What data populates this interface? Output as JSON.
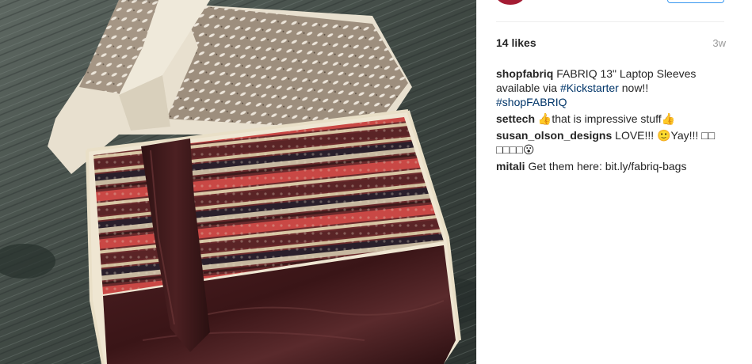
{
  "post": {
    "likes": "14 likes",
    "time": "3w"
  },
  "caption": {
    "user": "shopfabriq",
    "text_start": "FABRIQ 13\" Laptop Sleeves available via ",
    "hashtag_kickstarter": "#Kickstarter",
    "text_end": " now!!",
    "hashtag_shop": "#shopFABRIQ"
  },
  "comments": [
    {
      "user": "settech",
      "text": "👍that is impressive stuff👍"
    },
    {
      "user": "susan_olson_designs",
      "text": "LOVE!!! 🙂Yay!!! □□ □□□□😮"
    },
    {
      "user": "mitali",
      "text": "Get them here: bit.ly/fabriq-bags"
    }
  ],
  "icons": {
    "avatar": "profile-avatar",
    "follow": "follow-button"
  },
  "colors": {
    "link": "#003569",
    "muted": "#999999",
    "follow_border": "#3897f0"
  }
}
